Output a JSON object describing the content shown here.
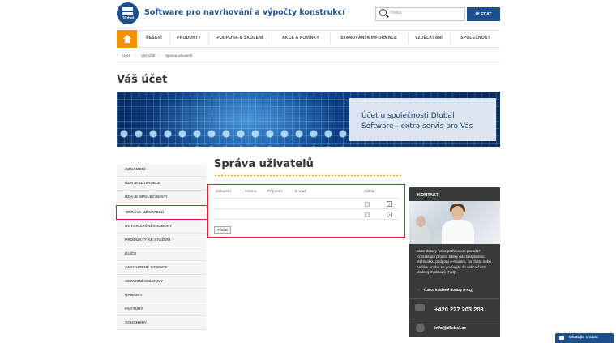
{
  "header": {
    "logo_text": "Dlubal",
    "tagline": "Software pro navrhování a výpočty konstrukcí",
    "search_placeholder": "Hledat",
    "search_button": "HLEDAT"
  },
  "nav": [
    "ŘEŠENÍ",
    "PRODUKTY",
    "PODPORA & ŠKOLENÍ",
    "AKCE A NOVINKY",
    "STANOVÁNÍ A INFORMACE",
    "VZDĚLÁVÁNÍ",
    "SPOLEČNOST"
  ],
  "breadcrumb": [
    "Účet",
    "Váš účet",
    "Správa uživatelů"
  ],
  "page_title": "Váš účet",
  "banner": {
    "line1": "Účet u společnosti Dlubal",
    "line2": "Software - extra servis pro Vás"
  },
  "sidebar": {
    "items": [
      "OZNÁMENÍ",
      "ÚDAJE UŽIVATELE",
      "ÚDAJE SPOLEČNOSTI",
      "SPRÁVA UŽIVATELŮ",
      "AUTORIZAČNÍ SOUBORY",
      "PRODUKTY KE STAŽENÍ",
      "KLÍČE",
      "ZAKOUPENÉ LICENCE",
      "SERVISNÍ SMLOUVY",
      "NABÍDKY",
      "FAKTURY",
      "VOUCHERY"
    ],
    "active": "SPRÁVA UŽIVATELŮ"
  },
  "main": {
    "title": "Správa uživatelů",
    "table_headers": [
      "Oslovení",
      "Jméno",
      "Příjmení",
      "E-mail",
      "Admin"
    ],
    "rows": [
      {
        "admin": "checked",
        "delete": "x"
      },
      {
        "admin": "unchecked",
        "delete": "x"
      }
    ],
    "add_button": "Přidat"
  },
  "contact": {
    "title": "KONTAKT",
    "text": "Máte dotazy nebo potřebujete poradit? Kontaktujte prosím lidský náš bezplatnou technickou podporu e-mailem, na chatu nebo na fóru anebo se podívejte do sekce často kladených dotazů (FAQ).",
    "faq_link": "Často kladené dotazy (FAQ)",
    "phone": "+420 227 203 203",
    "email": "info@dlubal.cz"
  },
  "chat": {
    "label": "Chatujte s námi"
  },
  "colors": {
    "brand_blue": "#1d4f8b",
    "accent_orange": "#f29400",
    "highlight_red": "#d61f26",
    "contact_panel": "#3a3a3a"
  }
}
